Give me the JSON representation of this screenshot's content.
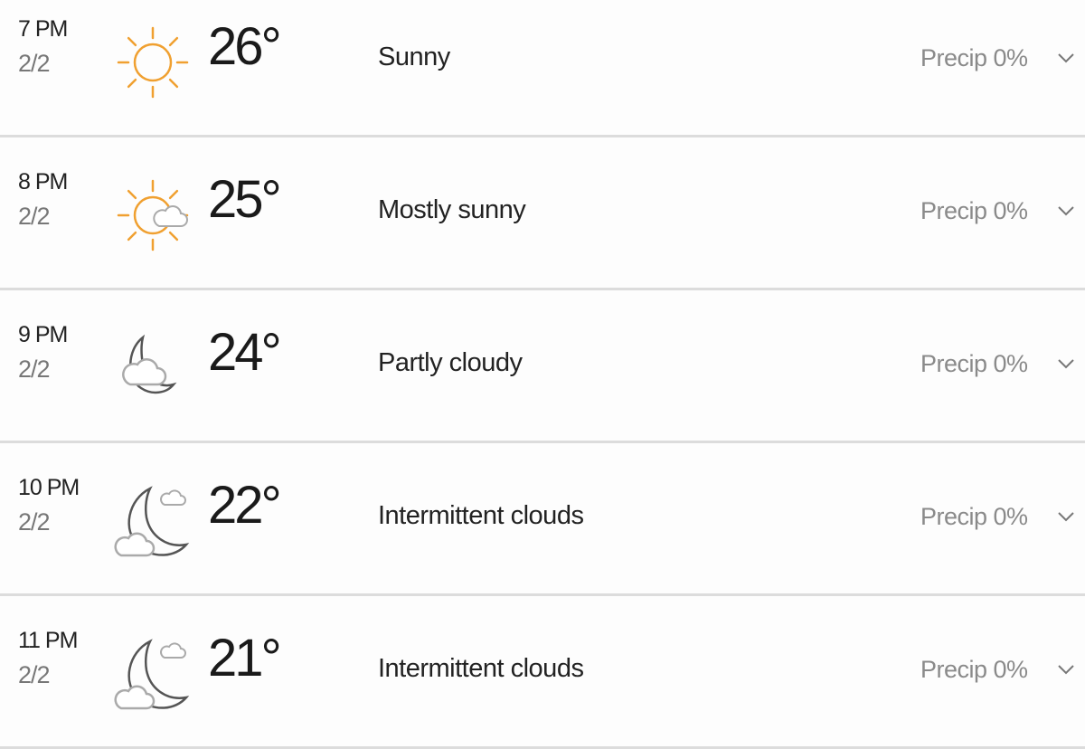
{
  "hours": [
    {
      "time": "7 PM",
      "date": "2/2",
      "icon": "sun-icon",
      "temp": "26°",
      "condition": "Sunny",
      "precip": "Precip 0%"
    },
    {
      "time": "8 PM",
      "date": "2/2",
      "icon": "mostly-sunny-icon",
      "temp": "25°",
      "condition": "Mostly sunny",
      "precip": "Precip 0%"
    },
    {
      "time": "9 PM",
      "date": "2/2",
      "icon": "moon-partly-cloudy-icon",
      "temp": "24°",
      "condition": "Partly cloudy",
      "precip": "Precip 0%"
    },
    {
      "time": "10 PM",
      "date": "2/2",
      "icon": "moon-intermittent-clouds-icon",
      "temp": "22°",
      "condition": "Intermittent clouds",
      "precip": "Precip 0%"
    },
    {
      "time": "11 PM",
      "date": "2/2",
      "icon": "moon-intermittent-clouds-icon",
      "temp": "21°",
      "condition": "Intermittent clouds",
      "precip": "Precip 0%"
    }
  ],
  "colors": {
    "sun": "#f0a030",
    "night": "#555555",
    "cloud": "#aaaaaa",
    "divider": "#dcdcdc"
  }
}
